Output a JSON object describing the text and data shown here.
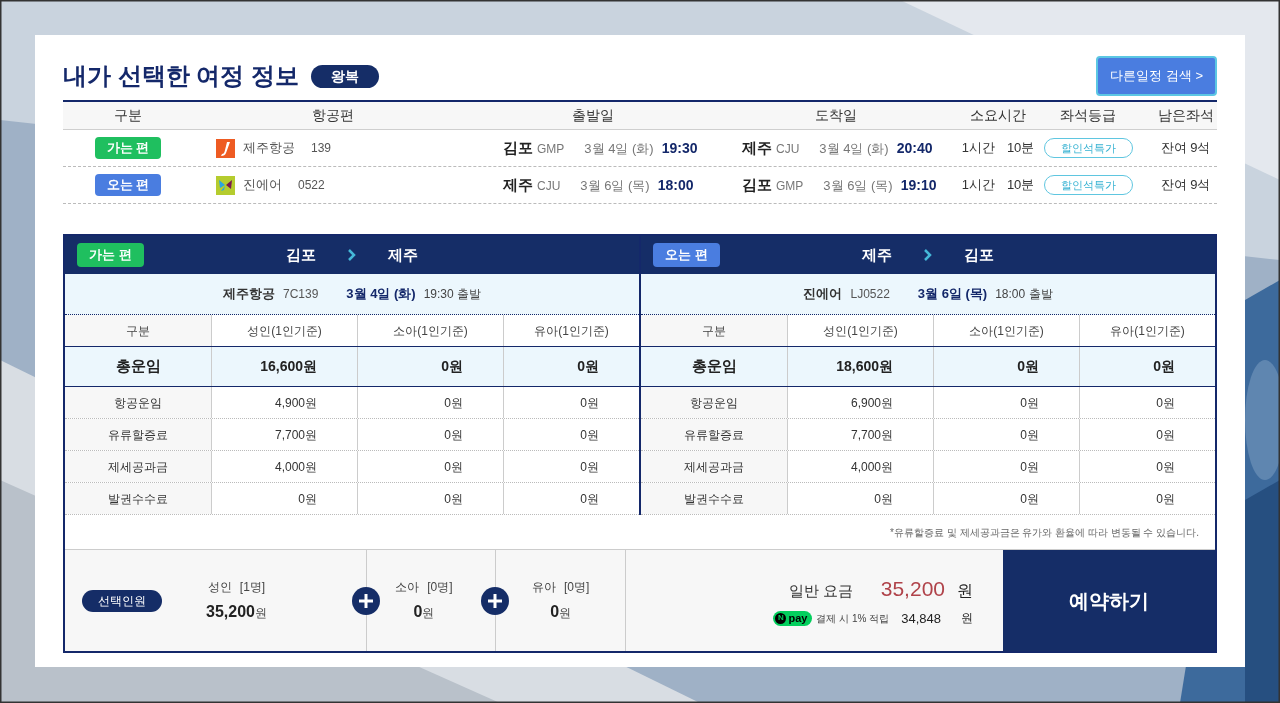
{
  "header": {
    "title": "내가 선택한 여정 정보",
    "trip_type": "왕복",
    "search_button": "다른일정 검색 >"
  },
  "summary": {
    "columns": [
      "구분",
      "항공편",
      "출발일",
      "도착일",
      "소요시간",
      "좌석등급",
      "남은좌석"
    ],
    "rows": [
      {
        "leg": "가는 편",
        "color": "#1fbf5f",
        "kind": "jeju",
        "airline": "제주항공",
        "flight": "139",
        "dep_city": "김포",
        "dep_code": "GMP",
        "dep_date": "3월 4일 (화)",
        "dep_time": "19:30",
        "arr_city": "제주",
        "arr_code": "CJU",
        "arr_date": "3월 4일 (화)",
        "arr_time": "20:40",
        "duration_h": "1시간",
        "duration_m": "10분",
        "seat_class": "할인석특가",
        "seats_left": "잔여 9석"
      },
      {
        "leg": "오는 편",
        "color": "#4a7de0",
        "kind": "jinair",
        "airline": "진에어",
        "flight": "0522",
        "dep_city": "제주",
        "dep_code": "CJU",
        "dep_date": "3월 6일 (목)",
        "dep_time": "18:00",
        "arr_city": "김포",
        "arr_code": "GMP",
        "arr_date": "3월 6일 (목)",
        "arr_time": "19:10",
        "duration_h": "1시간",
        "duration_m": "10분",
        "seat_class": "할인석특가",
        "seats_left": "잔여 9석"
      }
    ]
  },
  "fares": [
    {
      "leg": "가는 편",
      "color": "#1fbf5f",
      "from": "김포",
      "to": "제주",
      "airline": "제주항공",
      "flight": "7C139",
      "date": "3월 4일 (화)",
      "departure": "19:30 출발",
      "columns": [
        "구분",
        "성인(1인기준)",
        "소아(1인기준)",
        "유아(1인기준)"
      ],
      "rows": [
        {
          "kind": "total",
          "cells": [
            "총운임",
            "16,600원",
            "0원",
            "0원"
          ]
        },
        {
          "kind": "item",
          "cells": [
            "항공운임",
            "4,900원",
            "0원",
            "0원"
          ]
        },
        {
          "kind": "item",
          "cells": [
            "유류할증료",
            "7,700원",
            "0원",
            "0원"
          ]
        },
        {
          "kind": "item",
          "cells": [
            "제세공과금",
            "4,000원",
            "0원",
            "0원"
          ]
        },
        {
          "kind": "item",
          "cells": [
            "발권수수료",
            "0원",
            "0원",
            "0원"
          ]
        }
      ]
    },
    {
      "leg": "오는 편",
      "color": "#4a7de0",
      "from": "제주",
      "to": "김포",
      "airline": "진에어",
      "flight": "LJ0522",
      "date": "3월 6일 (목)",
      "departure": "18:00 출발",
      "columns": [
        "구분",
        "성인(1인기준)",
        "소아(1인기준)",
        "유아(1인기준)"
      ],
      "rows": [
        {
          "kind": "total",
          "cells": [
            "총운임",
            "18,600원",
            "0원",
            "0원"
          ]
        },
        {
          "kind": "item",
          "cells": [
            "항공운임",
            "6,900원",
            "0원",
            "0원"
          ]
        },
        {
          "kind": "item",
          "cells": [
            "유류할증료",
            "7,700원",
            "0원",
            "0원"
          ]
        },
        {
          "kind": "item",
          "cells": [
            "제세공과금",
            "4,000원",
            "0원",
            "0원"
          ]
        },
        {
          "kind": "item",
          "cells": [
            "발권수수료",
            "0원",
            "0원",
            "0원"
          ]
        }
      ]
    }
  ],
  "note": "*유류할증료 및 제세공과금은 유가와 환율에 따라 변동될 수 있습니다.",
  "passengers": {
    "label": "선택인원",
    "groups": [
      {
        "type": "성인",
        "count": "[1명]",
        "amount": "35,200",
        "unit": "원"
      },
      {
        "type": "소아",
        "count": "[0명]",
        "amount": "0",
        "unit": "원"
      },
      {
        "type": "유아",
        "count": "[0명]",
        "amount": "0",
        "unit": "원"
      }
    ]
  },
  "total": {
    "label": "일반 요금",
    "amount": "35,200",
    "unit": "원",
    "npay_mark": "N",
    "npay_word": "pay",
    "npay_text": "결제 시 1% 적립",
    "npay_amount": "34,848",
    "npay_unit": "원"
  },
  "reserve_button": "예약하기"
}
